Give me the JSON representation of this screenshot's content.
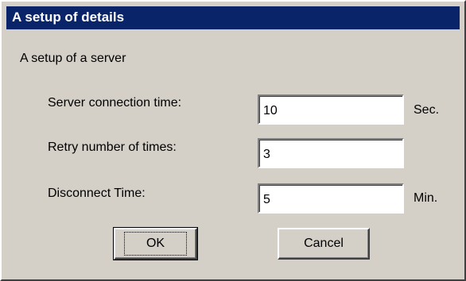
{
  "window": {
    "title": "A setup of details"
  },
  "group": {
    "label": "A setup of a server"
  },
  "fields": [
    {
      "label": "Server connection time:",
      "value": "10",
      "unit": "Sec."
    },
    {
      "label": "Retry number of times:",
      "value": "3",
      "unit": ""
    },
    {
      "label": "Disconnect Time:",
      "value": "5",
      "unit": "Min."
    }
  ],
  "buttons": {
    "ok_label": "OK",
    "cancel_label": "Cancel"
  },
  "colors": {
    "titlebar": "#0a246a",
    "face": "#d4d0c8"
  }
}
